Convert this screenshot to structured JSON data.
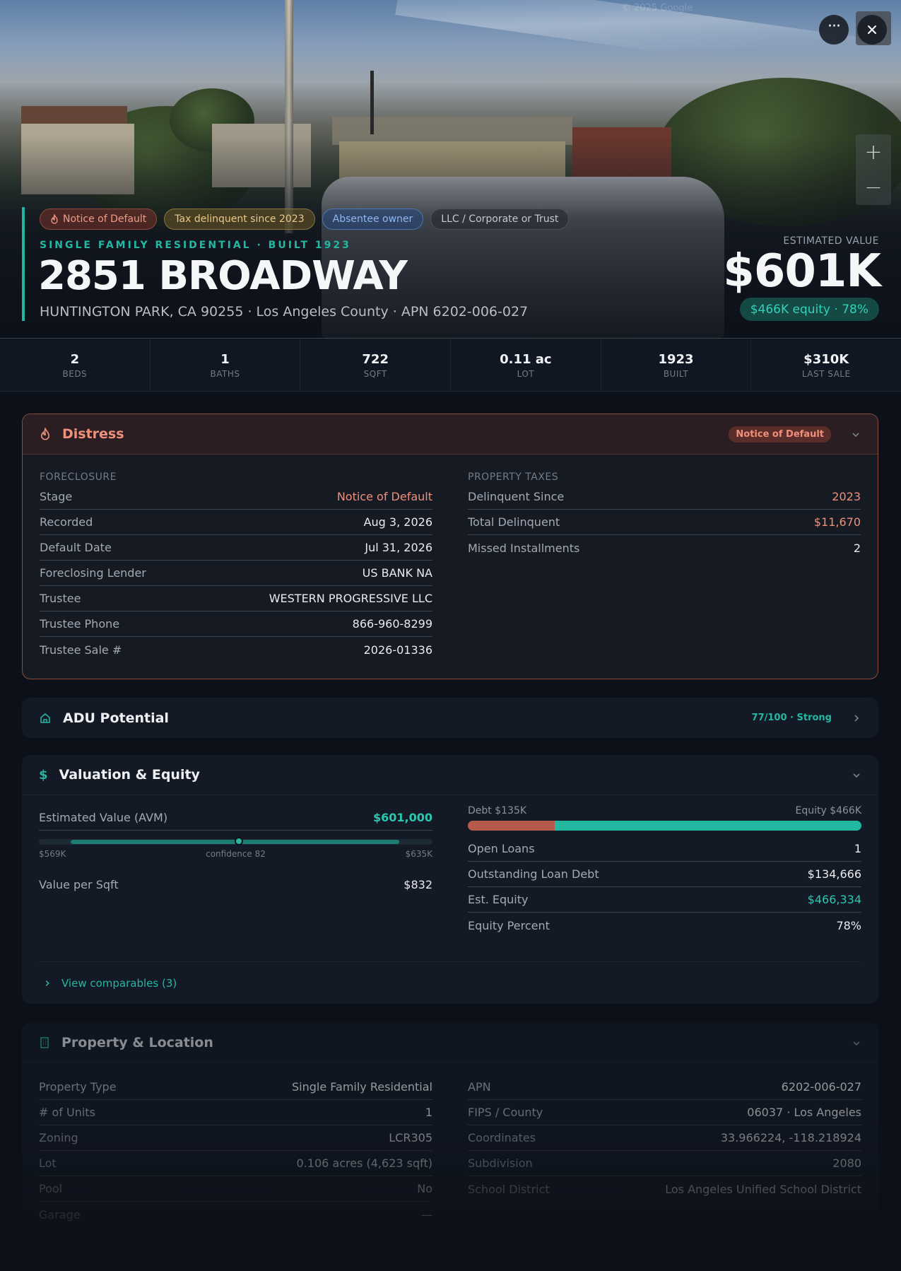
{
  "hero": {
    "tags": [
      {
        "label": "Notice of Default"
      },
      {
        "label": "Tax delinquent since 2023"
      },
      {
        "label": "Absentee owner"
      },
      {
        "label": "LLC / Corporate or Trust"
      }
    ],
    "subtitle": "SINGLE FAMILY RESIDENTIAL · BUILT 1923",
    "title": "2851 BROADWAY",
    "address": "HUNTINGTON PARK, CA 90255 · Los Angeles County · APN 6202-006-027",
    "estimated_label": "ESTIMATED VALUE",
    "estimated_value": "$601K",
    "equity_pill": "$466K equity · 78%",
    "watermark": "© 2025 Google"
  },
  "stats": [
    {
      "value": "2",
      "label": "BEDS"
    },
    {
      "value": "1",
      "label": "BATHS"
    },
    {
      "value": "722",
      "label": "SQFT"
    },
    {
      "value": "0.11 ac",
      "label": "LOT"
    },
    {
      "value": "1923",
      "label": "BUILT"
    },
    {
      "value": "$310K",
      "label": "LAST SALE"
    }
  ],
  "distress": {
    "title": "Distress",
    "badge": "Notice of Default",
    "foreclosure": {
      "heading": "FORECLOSURE",
      "rows": [
        {
          "k": "Stage",
          "v": "Notice of Default"
        },
        {
          "k": "Recorded",
          "v": "Aug 3, 2026"
        },
        {
          "k": "Default Date",
          "v": "Jul 31, 2026"
        },
        {
          "k": "Foreclosing Lender",
          "v": "US BANK NA"
        },
        {
          "k": "Trustee",
          "v": "WESTERN PROGRESSIVE LLC"
        },
        {
          "k": "Trustee Phone",
          "v": "866-960-8299"
        },
        {
          "k": "Trustee Sale #",
          "v": "2026-01336"
        }
      ]
    },
    "taxes": {
      "heading": "PROPERTY TAXES",
      "rows": [
        {
          "k": "Delinquent Since",
          "v": "2023"
        },
        {
          "k": "Total Delinquent",
          "v": "$11,670"
        },
        {
          "k": "Missed Installments",
          "v": "2"
        }
      ]
    }
  },
  "adu": {
    "title": "ADU Potential",
    "score": "77/100 · Strong"
  },
  "valuation": {
    "title": "Valuation & Equity",
    "avm_label": "Estimated Value (AVM)",
    "avm_value": "$601,000",
    "range_low": "$569K",
    "range_mid": "confidence 82",
    "range_high": "$635K",
    "value_per_sqft_label": "Value per Sqft",
    "value_per_sqft": "$832",
    "debt_label": "Debt $135K",
    "equity_label": "Equity $466K",
    "equity_fraction": 0.78,
    "rows": [
      {
        "k": "Open Loans",
        "v": "1"
      },
      {
        "k": "Outstanding Loan Debt",
        "v": "$134,666"
      },
      {
        "k": "Est. Equity",
        "v": "$466,334"
      },
      {
        "k": "Equity Percent",
        "v": "78%"
      }
    ],
    "comparables_link": "View comparables (3)"
  },
  "property": {
    "title": "Property & Location",
    "left_rows": [
      {
        "k": "Property Type",
        "v": "Single Family Residential"
      },
      {
        "k": "# of Units",
        "v": "1"
      },
      {
        "k": "Zoning",
        "v": "LCR305"
      },
      {
        "k": "Lot",
        "v": "0.106 acres (4,623 sqft)"
      },
      {
        "k": "Pool",
        "v": "No"
      },
      {
        "k": "Garage",
        "v": "—"
      }
    ],
    "right_rows": [
      {
        "k": "APN",
        "v": "6202-006-027"
      },
      {
        "k": "FIPS / County",
        "v": "06037 · Los Angeles"
      },
      {
        "k": "Coordinates",
        "v": "33.966224, -118.218924"
      },
      {
        "k": "Subdivision",
        "v": "2080"
      },
      {
        "k": "School District",
        "v": "Los Angeles Unified School District"
      }
    ]
  },
  "colors": {
    "accent": "#24b7a2",
    "distress": "#f0907a",
    "background": "#0c1018"
  }
}
